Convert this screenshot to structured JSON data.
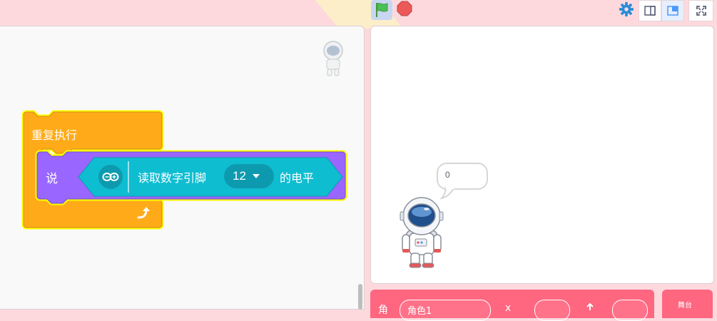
{
  "toolbar": {
    "green_flag_icon": "green-flag-icon",
    "stop_icon": "stop-icon",
    "settings_icon": "gear-icon",
    "small_stage_icon": "small-stage-icon",
    "large_stage_icon": "large-stage-icon",
    "fullscreen_icon": "fullscreen-icon"
  },
  "code": {
    "repeat_label": "重复执行",
    "say_label": "说",
    "read_pin_label": "读取数字引脚",
    "pin_value": "12",
    "level_label": "的电平"
  },
  "stage": {
    "speech_text": "0"
  },
  "sprite_panel": {
    "sprite_label": "角",
    "sprite_name_partial": "角色1",
    "x_label": "x"
  },
  "stage_tab": {
    "label": "舞台"
  },
  "colors": {
    "page_bg": "#fdd9de",
    "control_orange": "#ffab19",
    "looks_purple": "#9966ff",
    "extension_teal": "#0fbdd1",
    "highlight_yellow": "#ffff00",
    "sprite_panel": "#ff6680"
  }
}
